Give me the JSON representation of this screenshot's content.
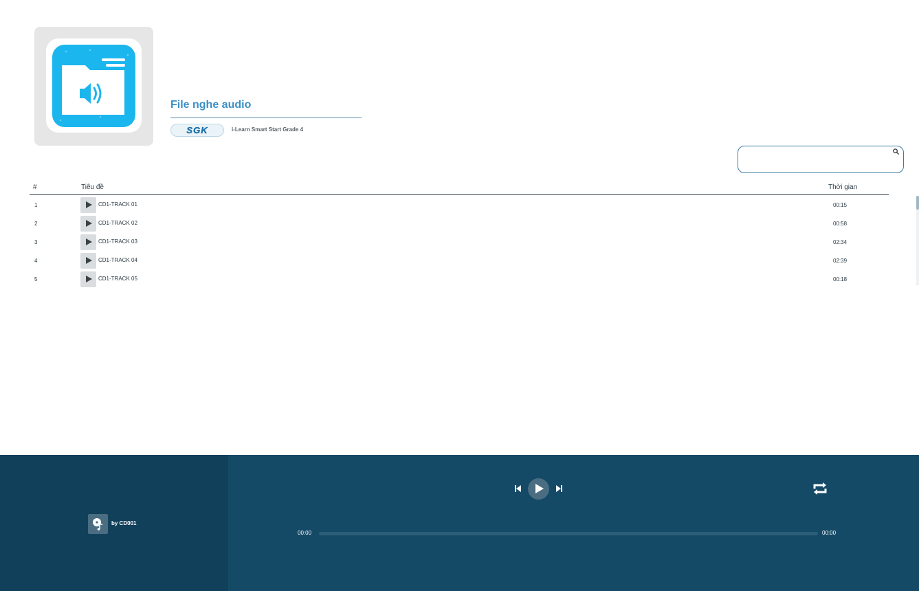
{
  "header": {
    "cover_icon": "folder-audio-icon",
    "title": "File nghe audio",
    "publisher_logo_text": "SGK",
    "book_name": "i-Learn Smart Start Grade 4"
  },
  "search": {
    "placeholder": "",
    "value": ""
  },
  "table": {
    "columns": {
      "number": "#",
      "title": "Tiêu đề",
      "duration": "Thời gian"
    },
    "rows": [
      {
        "number": "1",
        "title": "CD1-TRACK 01",
        "duration": "00:15"
      },
      {
        "number": "2",
        "title": "CD1-TRACK 02",
        "duration": "00:58"
      },
      {
        "number": "3",
        "title": "CD1-TRACK 03",
        "duration": "02:34"
      },
      {
        "number": "4",
        "title": "CD1-TRACK 04",
        "duration": "02:39"
      },
      {
        "number": "5",
        "title": "CD1-TRACK 05",
        "duration": "00:18"
      }
    ]
  },
  "player": {
    "artist": "by CD001",
    "current_time": "00:00",
    "duration": "00:00",
    "progress": 0,
    "colors": {
      "bar": "#154a67",
      "left_panel": "#11405a",
      "accent": "#3a8fc6"
    }
  }
}
